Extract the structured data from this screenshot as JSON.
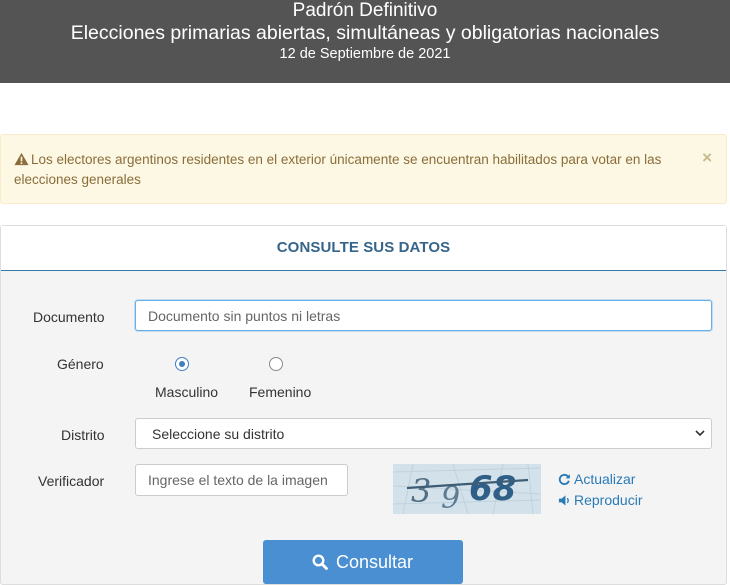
{
  "header": {
    "title": "Padrón Definitivo",
    "subtitle": "Elecciones primarias abiertas, simultáneas y obligatorias nacionales",
    "date": "12 de Septiembre de 2021"
  },
  "alert": {
    "message": "Los electores argentinos residentes en el exterior únicamente se encuentran habilitados para votar en las elecciones generales",
    "close": "×",
    "icon": "warning-icon"
  },
  "form": {
    "title": "CONSULTE SUS DATOS",
    "documento": {
      "label": "Documento",
      "placeholder": "Documento sin puntos ni letras",
      "value": ""
    },
    "genero": {
      "label": "Género",
      "options": [
        {
          "label": "Masculino",
          "checked": true
        },
        {
          "label": "Femenino",
          "checked": false
        }
      ]
    },
    "distrito": {
      "label": "Distrito",
      "selected": "Seleccione su distrito"
    },
    "verificador": {
      "label": "Verificador",
      "placeholder": "Ingrese el texto de la imagen",
      "value": "",
      "captcha_text": "3968",
      "refresh_label": "Actualizar",
      "play_label": "Reproducir"
    },
    "submit_label": "Consultar"
  },
  "colors": {
    "header_bg": "#545454",
    "alert_bg": "#fcf8e3",
    "alert_text": "#8a6d3b",
    "accent": "#35658a",
    "button": "#4a8fd1",
    "link": "#2a7ab8"
  }
}
